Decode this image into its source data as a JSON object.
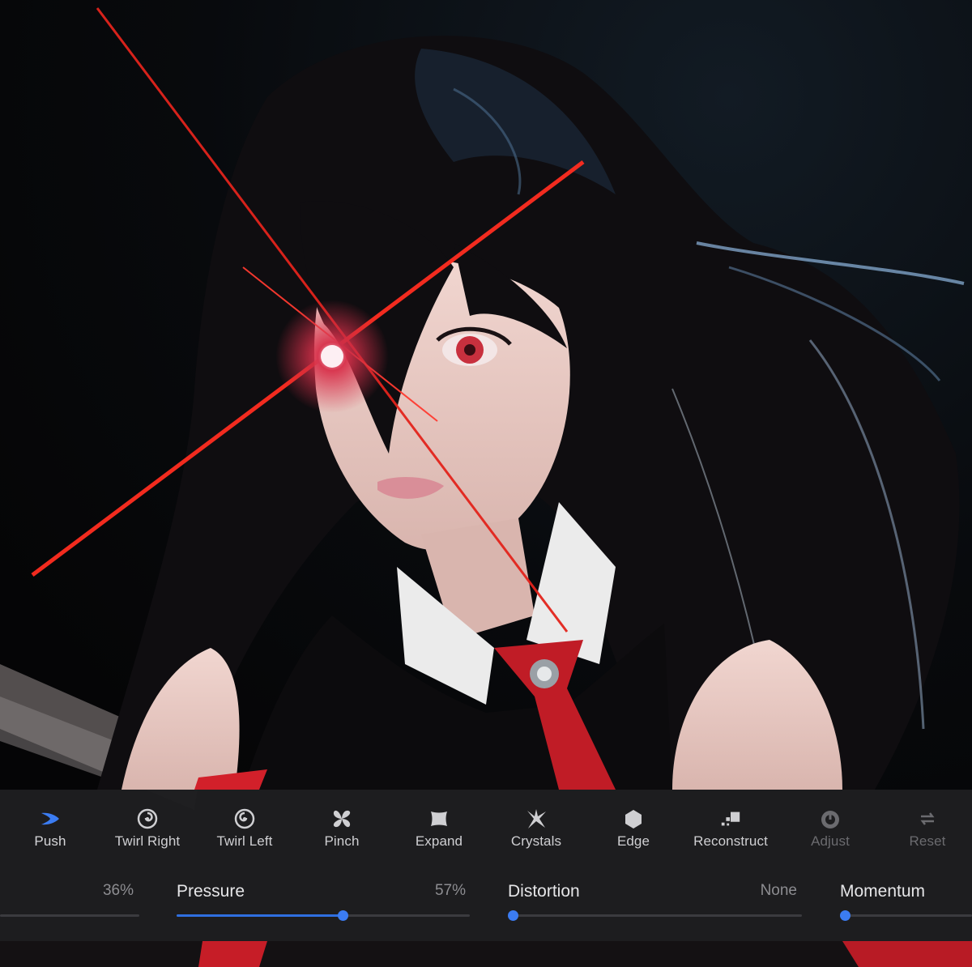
{
  "tools": [
    {
      "label": "Push",
      "icon": "push-icon",
      "state": "active"
    },
    {
      "label": "Twirl Right",
      "icon": "twirl-right-icon",
      "state": "normal"
    },
    {
      "label": "Twirl Left",
      "icon": "twirl-left-icon",
      "state": "normal"
    },
    {
      "label": "Pinch",
      "icon": "pinch-icon",
      "state": "normal"
    },
    {
      "label": "Expand",
      "icon": "expand-icon",
      "state": "normal"
    },
    {
      "label": "Crystals",
      "icon": "crystals-icon",
      "state": "normal"
    },
    {
      "label": "Edge",
      "icon": "edge-icon",
      "state": "normal"
    },
    {
      "label": "Reconstruct",
      "icon": "reconstruct-icon",
      "state": "normal"
    },
    {
      "label": "Adjust",
      "icon": "adjust-icon",
      "state": "disabled"
    },
    {
      "label": "Reset",
      "icon": "reset-icon",
      "state": "disabled"
    }
  ],
  "sliders": {
    "size": {
      "value": "36%",
      "level": 0.36
    },
    "pressure": {
      "name": "Pressure",
      "value": "57%",
      "level": 0.57
    },
    "distortion": {
      "name": "Distortion",
      "value": "None",
      "level": 0
    },
    "momentum": {
      "name": "Momentum",
      "level": 0
    }
  },
  "colors": {
    "accent": "#3b7cf2",
    "panel_bg": "#1e1e20",
    "label": "#cfcfd2",
    "disabled": "#6b6b6f",
    "lens_flare": "#e3241c"
  }
}
